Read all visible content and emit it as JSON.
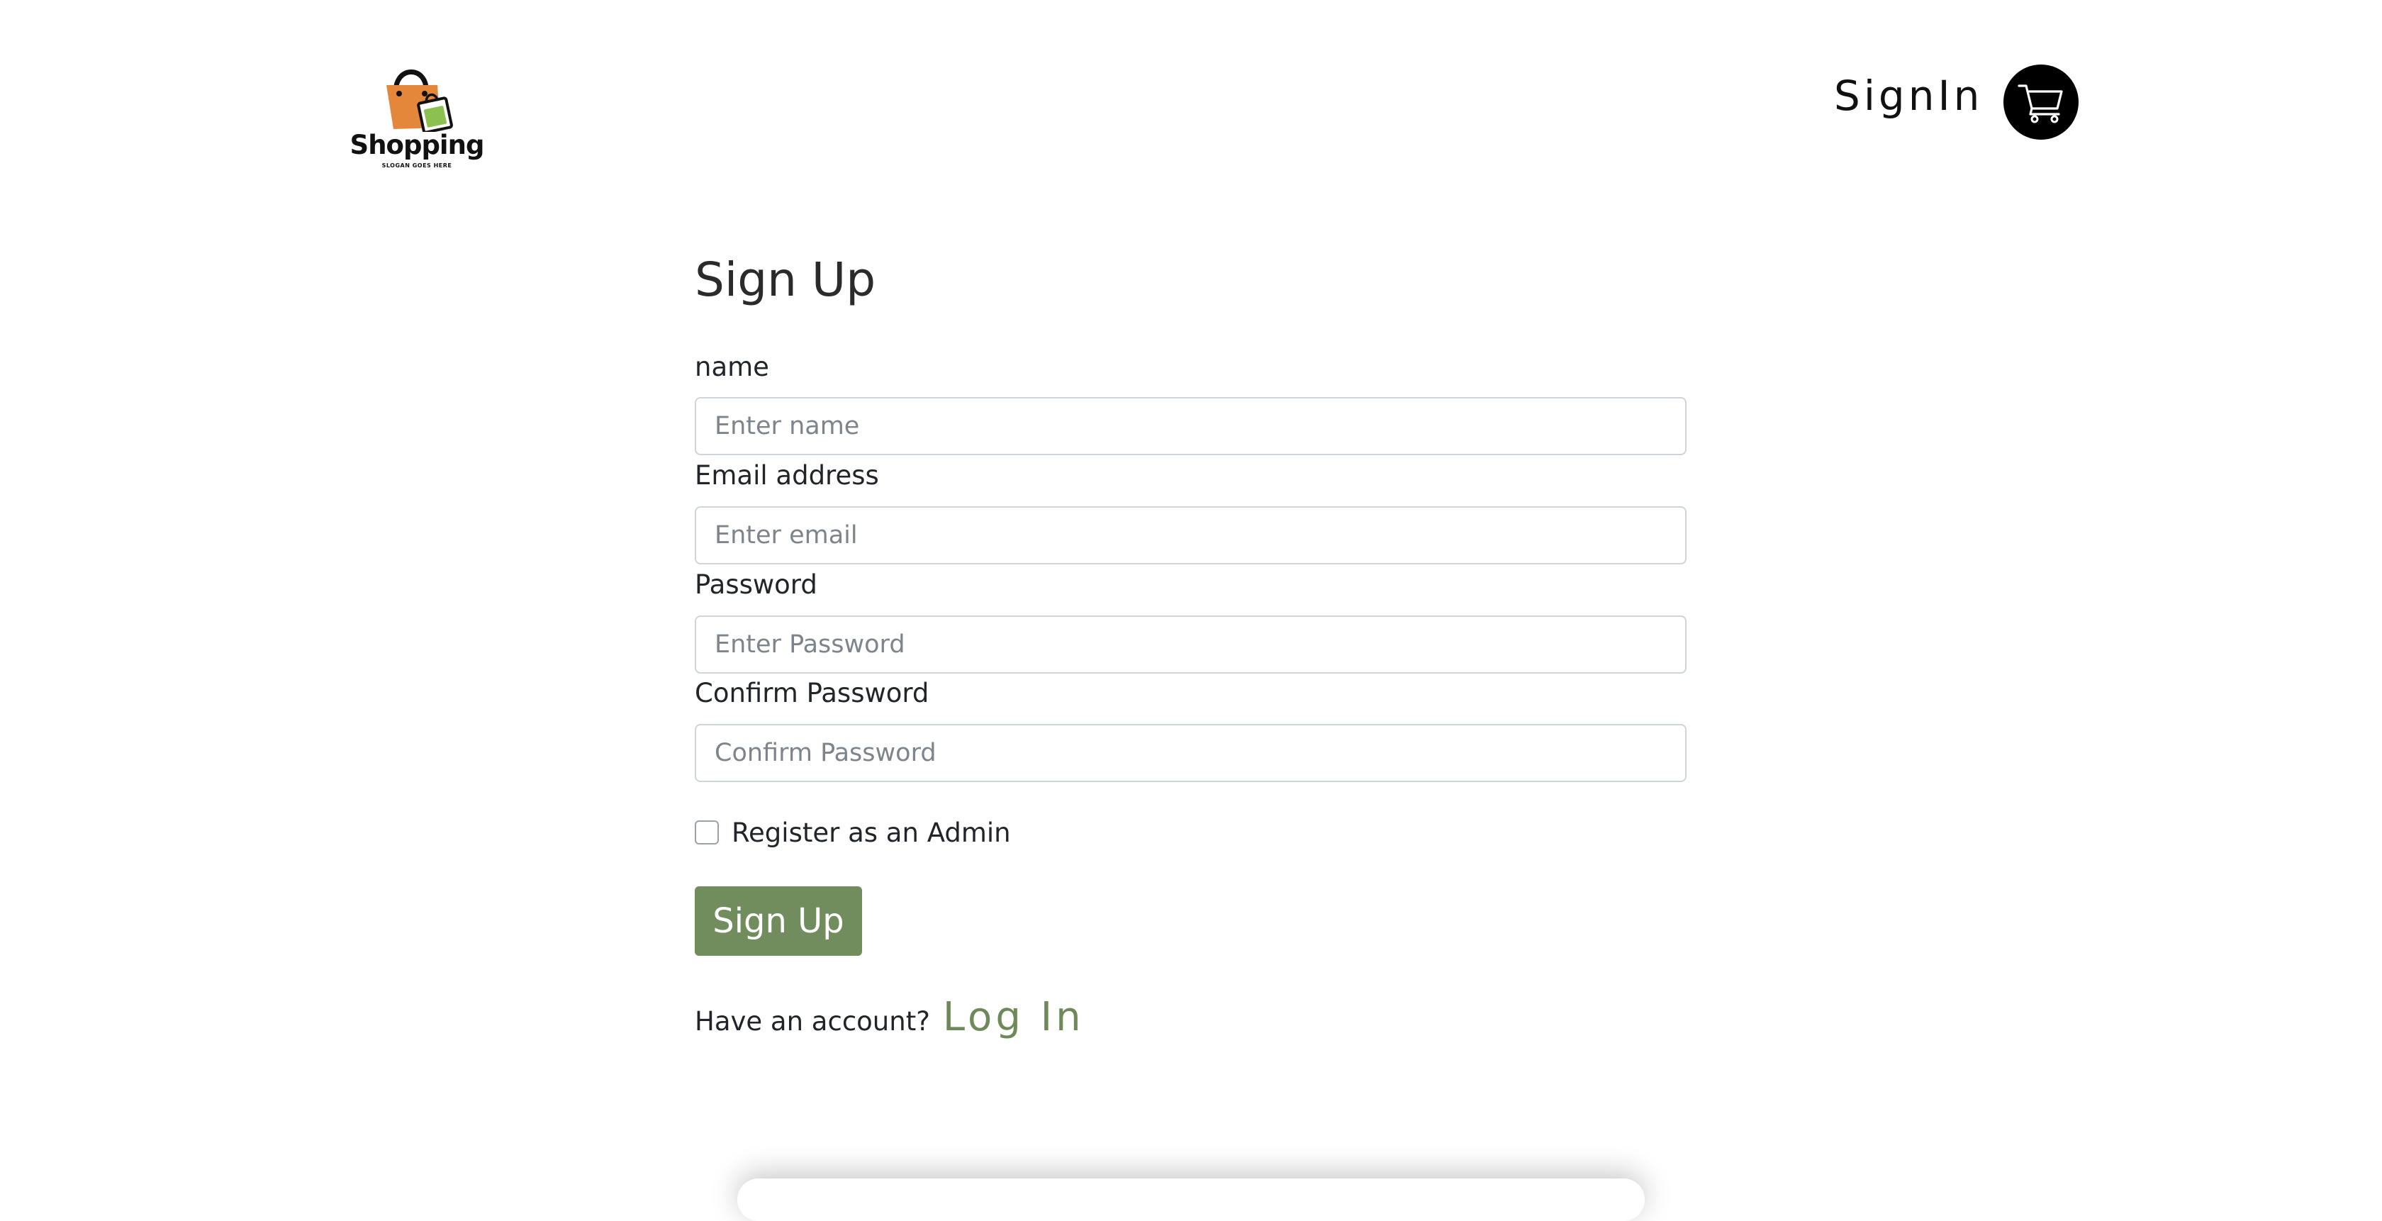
{
  "header": {
    "logo": {
      "name": "Shopping",
      "slogan": "SLOGAN GOES HERE"
    },
    "nav_signin": "SignIn",
    "cart_icon": "cart-icon"
  },
  "form": {
    "title": "Sign Up",
    "fields": [
      {
        "label": "name",
        "placeholder": "Enter name",
        "value": ""
      },
      {
        "label": "Email address",
        "placeholder": "Enter email",
        "value": ""
      },
      {
        "label": "Password",
        "placeholder": "Enter Password",
        "value": ""
      },
      {
        "label": "Confirm Password",
        "placeholder": "Confirm Password",
        "value": ""
      }
    ],
    "admin_checkbox": {
      "label": "Register as an Admin",
      "checked": false
    },
    "submit_label": "Sign Up",
    "account_prompt": "Have an account?",
    "login_link": "Log In"
  },
  "colors": {
    "accent": "#718c5d",
    "link": "#6f8a5a",
    "cart_bg": "#000000",
    "bag_orange": "#e5873a",
    "bag_green": "#8cc152"
  }
}
